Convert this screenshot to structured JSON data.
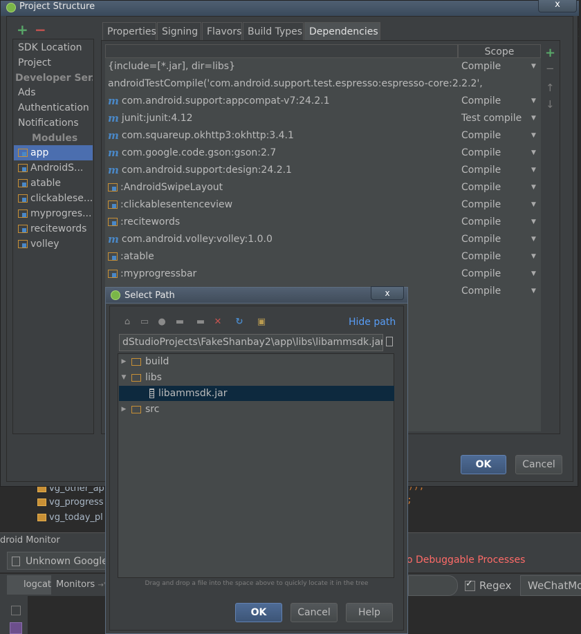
{
  "ide": {
    "files": [
      "vg_other_ap",
      "vg_progress",
      "vg_today_pl"
    ],
    "monitor_title": "droid Monitor",
    "device": "Unknown Google",
    "no_debuggable": "o Debuggable Processes",
    "tabs": {
      "logcat": "logcat",
      "monitors": "Monitors"
    },
    "regex_label": "Regex",
    "filter_value": "WeChatMo"
  },
  "project_structure": {
    "title": "Project Structure",
    "close_glyph": "x",
    "toolbar": {
      "add": "+",
      "remove": "−"
    },
    "sidebar": {
      "items": [
        "SDK Location",
        "Project"
      ],
      "developer_header": "Developer Ser...",
      "services": [
        "Ads",
        "Authentication",
        "Notifications"
      ],
      "modules_header": "Modules",
      "modules": [
        "app",
        "AndroidS...",
        "atable",
        "clickablese...",
        "myprogres...",
        "recitewords",
        "volley"
      ],
      "selected_module": "app"
    },
    "tabs": [
      "Properties",
      "Signing",
      "Flavors",
      "Build Types",
      "Dependencies"
    ],
    "active_tab": "Dependencies",
    "dependencies": {
      "scope_header": "Scope",
      "rows": [
        {
          "icon": "none",
          "name": "{include=[*.jar], dir=libs}",
          "scope": "Compile"
        },
        {
          "icon": "none",
          "name": "androidTestCompile('com.android.support.test.espresso:espresso-core:2.2.2',",
          "scope": ""
        },
        {
          "icon": "maven",
          "name": "com.android.support:appcompat-v7:24.2.1",
          "scope": "Compile"
        },
        {
          "icon": "maven",
          "name": "junit:junit:4.12",
          "scope": "Test compile"
        },
        {
          "icon": "maven",
          "name": "com.squareup.okhttp3:okhttp:3.4.1",
          "scope": "Compile"
        },
        {
          "icon": "maven",
          "name": "com.google.code.gson:gson:2.7",
          "scope": "Compile"
        },
        {
          "icon": "maven",
          "name": "com.android.support:design:24.2.1",
          "scope": "Compile"
        },
        {
          "icon": "module",
          "name": ":AndroidSwipeLayout",
          "scope": "Compile"
        },
        {
          "icon": "module",
          "name": ":clickablesentenceview",
          "scope": "Compile"
        },
        {
          "icon": "module",
          "name": ":recitewords",
          "scope": "Compile"
        },
        {
          "icon": "maven",
          "name": "com.android.volley:volley:1.0.0",
          "scope": "Compile"
        },
        {
          "icon": "module",
          "name": ":atable",
          "scope": "Compile"
        },
        {
          "icon": "module",
          "name": ":myprogressbar",
          "scope": "Compile"
        },
        {
          "icon": "none",
          "name": "",
          "scope": "Compile"
        }
      ],
      "maven_glyph": "m"
    },
    "buttons": {
      "ok": "OK",
      "cancel": "Cancel"
    }
  },
  "select_path": {
    "title": "Select Path",
    "close_glyph": "x",
    "hide_path": "Hide path",
    "path": "dStudioProjects\\FakeShanbay2\\app\\libs\\libammsdk.jar",
    "tree": [
      {
        "label": "build",
        "type": "folder",
        "expanded": false
      },
      {
        "label": "libs",
        "type": "folder",
        "expanded": true
      },
      {
        "label": "libammsdk.jar",
        "type": "jar",
        "selected": true
      },
      {
        "label": "src",
        "type": "folder",
        "expanded": false
      }
    ],
    "hint": "Drag and drop a file into the space above to quickly locate it in the tree",
    "buttons": {
      "ok": "OK",
      "cancel": "Cancel",
      "help": "Help"
    }
  },
  "colors": {
    "accent": "#4b6eaf",
    "link": "#589df6",
    "error": "#ff6b68",
    "add": "#59a869",
    "remove": "#c75450"
  }
}
